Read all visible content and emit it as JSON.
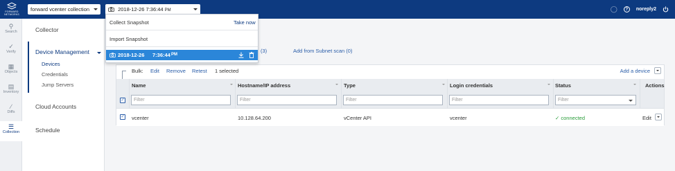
{
  "logo": {
    "text": "FORWARD NETWORKS"
  },
  "header": {
    "network_select": "forward vcenter collection",
    "snapshot_select": "2018-12-26 7:36:44",
    "snapshot_select_ampm": "PM",
    "username": "noreply2"
  },
  "rail": [
    {
      "label": "Search",
      "icon": "search-icon"
    },
    {
      "label": "Verify",
      "icon": "verify-icon"
    },
    {
      "label": "Objects",
      "icon": "objects-icon"
    },
    {
      "label": "Inventory",
      "icon": "inventory-icon"
    },
    {
      "label": "Diffs",
      "icon": "diffs-icon"
    },
    {
      "label": "Collection",
      "icon": "collection-icon"
    }
  ],
  "secnav": {
    "collector": "Collector",
    "device_management": "Device Management",
    "sub_items": [
      "Devices",
      "Credentials",
      "Jump Servers"
    ],
    "cloud_accounts": "Cloud Accounts",
    "schedule": "Schedule"
  },
  "tabs": {
    "tab_count_partial": "(3)",
    "subnet_scan": "Add from Subnet scan (0)"
  },
  "bulk": {
    "label": "Bulk:",
    "edit": "Edit",
    "remove": "Remove",
    "retest": "Retest",
    "selected": "1 selected",
    "add_device": "Add a device"
  },
  "table": {
    "columns": [
      "Name",
      "Hostname/IP address",
      "Type",
      "Login credentials",
      "Status",
      "Actions"
    ],
    "filter_placeholder": "Filter",
    "rows": [
      {
        "name": "vcenter",
        "host": "10.128.64.200",
        "type": "vCenter API",
        "credentials": "vcenter",
        "status": "connected",
        "action": "Edit"
      }
    ]
  },
  "snapshot_dropdown": {
    "collect_label": "Collect Snapshot",
    "take_now": "Take now",
    "import_label": "Import Snapshot",
    "selected_date": "2018-12-26",
    "selected_time": "7:36:44",
    "selected_ampm": "PM"
  },
  "colors": {
    "brand": "#0d3a80",
    "accent": "#2b86d9",
    "status_ok": "#2a9d3a"
  }
}
